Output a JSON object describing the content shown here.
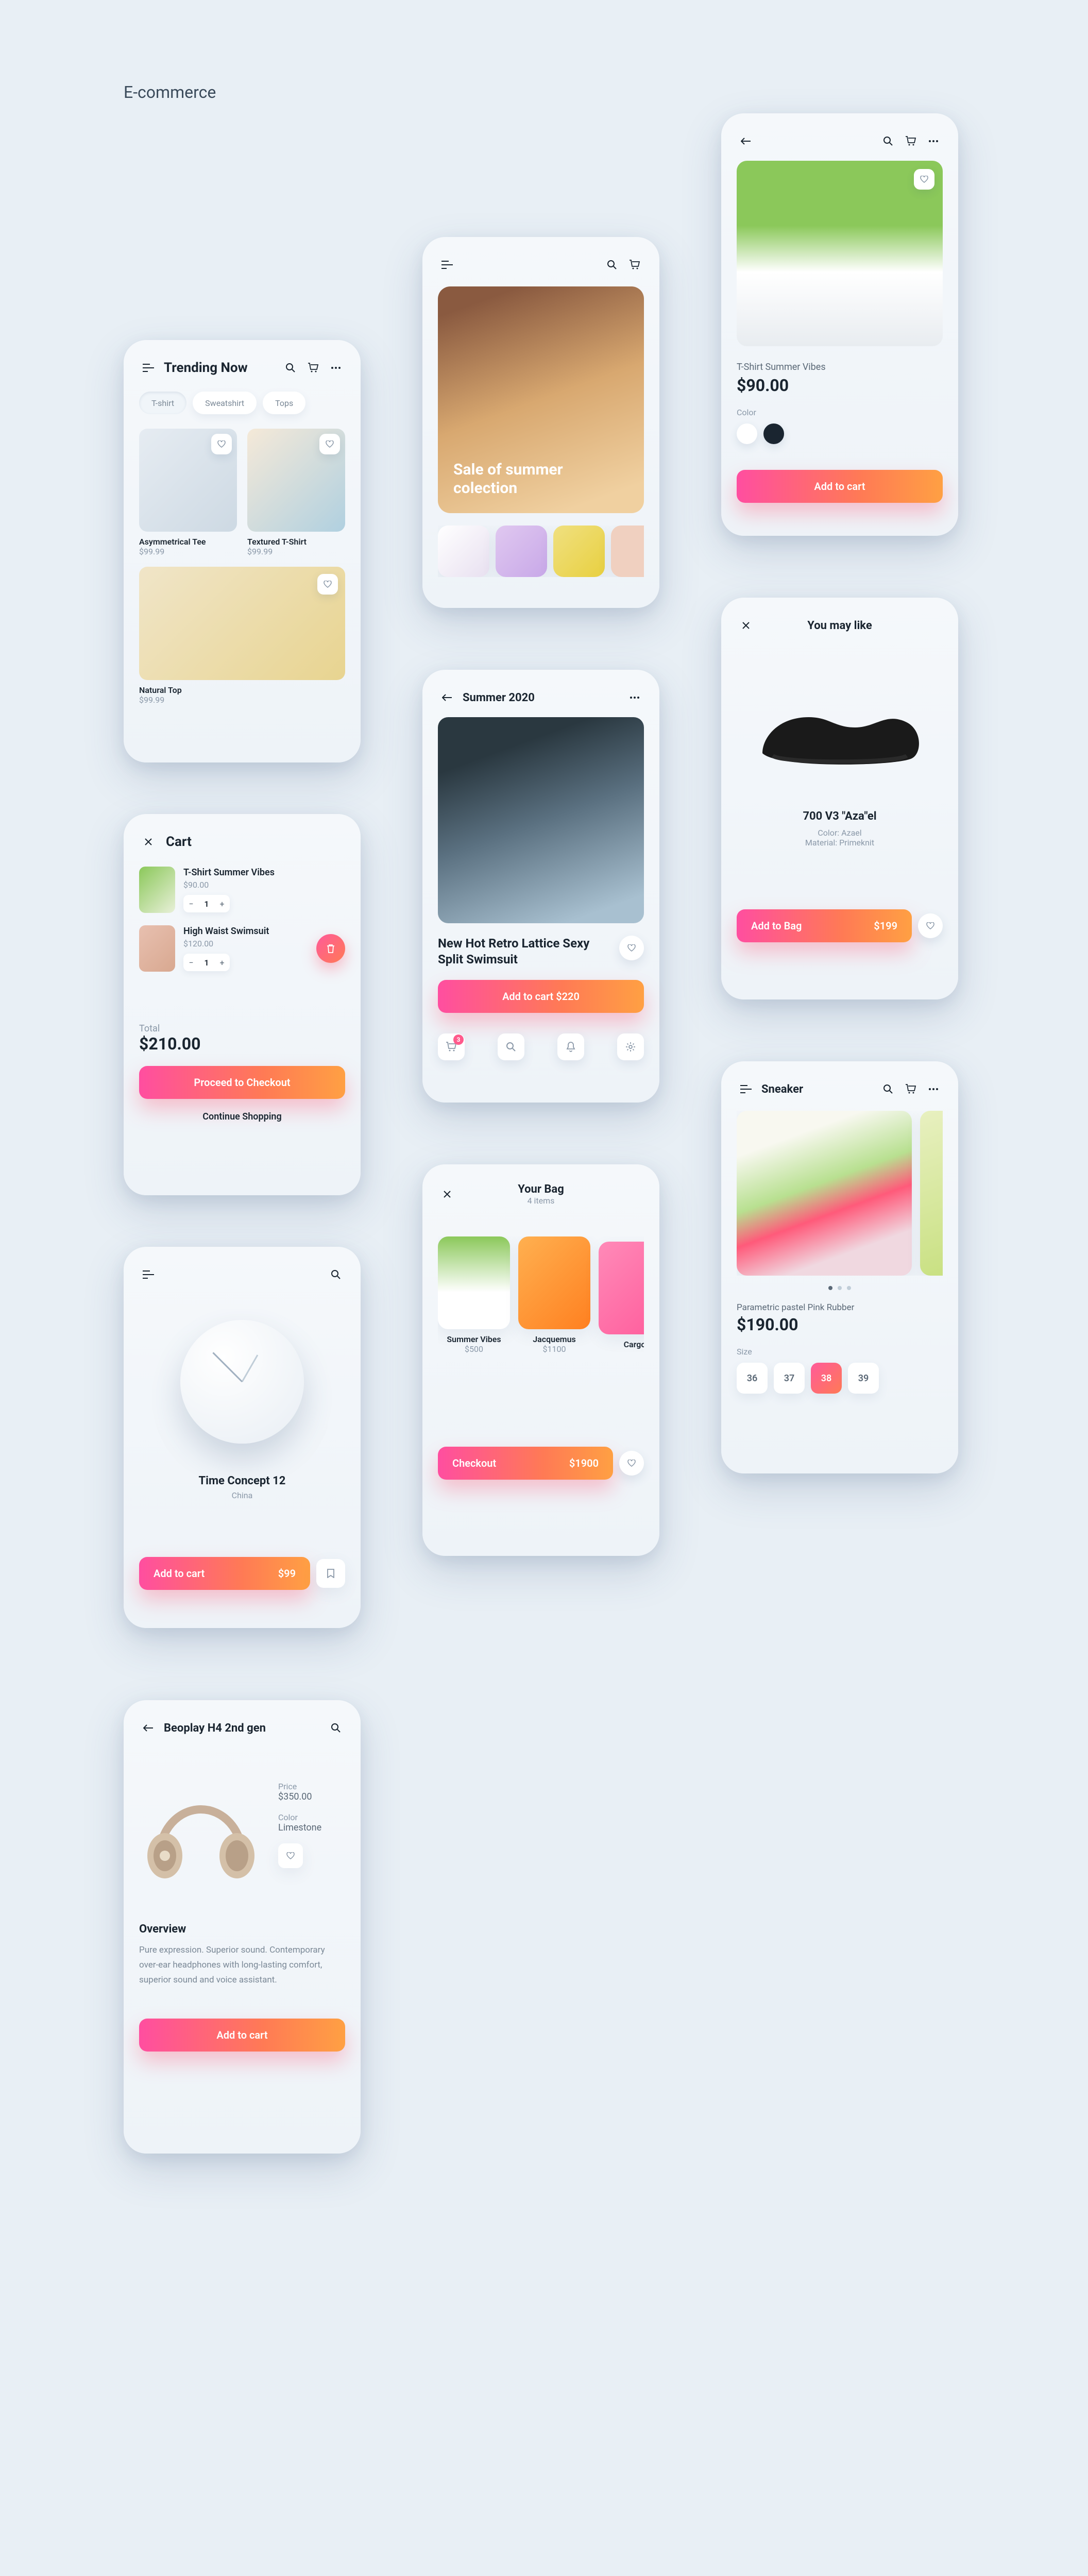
{
  "page_title": "E-commerce",
  "trending": {
    "title": "Trending Now",
    "chips": [
      "T-shirt",
      "Sweatshirt",
      "Tops"
    ],
    "items": [
      {
        "name": "Asymmetrical Tee",
        "price": "$99.99"
      },
      {
        "name": "Textured T-Shirt",
        "price": "$99.99"
      },
      {
        "name": "Natural Top",
        "price": "$99.99"
      }
    ]
  },
  "cart": {
    "title": "Cart",
    "items": [
      {
        "name": "T-Shirt Summer Vibes",
        "price": "$90.00",
        "qty": "1"
      },
      {
        "name": "High Waist Swimsuit",
        "price": "$120.00",
        "qty": "1"
      }
    ],
    "total_label": "Total",
    "total": "$210.00",
    "checkout": "Proceed to Checkout",
    "continue": "Continue Shopping"
  },
  "clock": {
    "title": "Time Concept 12",
    "origin": "China",
    "cta": "Add to cart",
    "price": "$99"
  },
  "headphones": {
    "title": "Beoplay H4 2nd gen",
    "price_label": "Price",
    "price": "$350.00",
    "color_label": "Color",
    "color": "Limestone",
    "overview_label": "Overview",
    "overview": "Pure expression. Superior sound. Contemporary over-ear headphones with long-lasting comfort, superior sound and voice assistant.",
    "cta": "Add to cart"
  },
  "hero": {
    "headline": "Sale of summer colection"
  },
  "summer": {
    "title": "Summer 2020",
    "product": "New Hot Retro Lattice Sexy Split Swimsuit",
    "cta": "Add to cart $220",
    "badge": "3"
  },
  "bag": {
    "title": "Your Bag",
    "count": "4 items",
    "items": [
      {
        "name": "Summer Vibes",
        "price": "$500"
      },
      {
        "name": "Jacquemus",
        "price": "$1100"
      },
      {
        "name": "Cargo",
        "price": ""
      }
    ],
    "checkout": "Checkout",
    "total": "$1900"
  },
  "tshirt": {
    "title": "T-Shirt Summer Vibes",
    "price": "$90.00",
    "color_label": "Color",
    "cta": "Add to cart"
  },
  "like": {
    "title": "You may like",
    "product": "700 V3 \"Aza\"el",
    "color": "Color: Azael",
    "material": "Material: Primeknit",
    "cta": "Add to Bag",
    "price": "$199"
  },
  "sneaker": {
    "title": "Sneaker",
    "product": "Parametric pastel Pink Rubber",
    "price": "$190.00",
    "size_label": "Size",
    "sizes": [
      "36",
      "37",
      "38",
      "39"
    ]
  }
}
